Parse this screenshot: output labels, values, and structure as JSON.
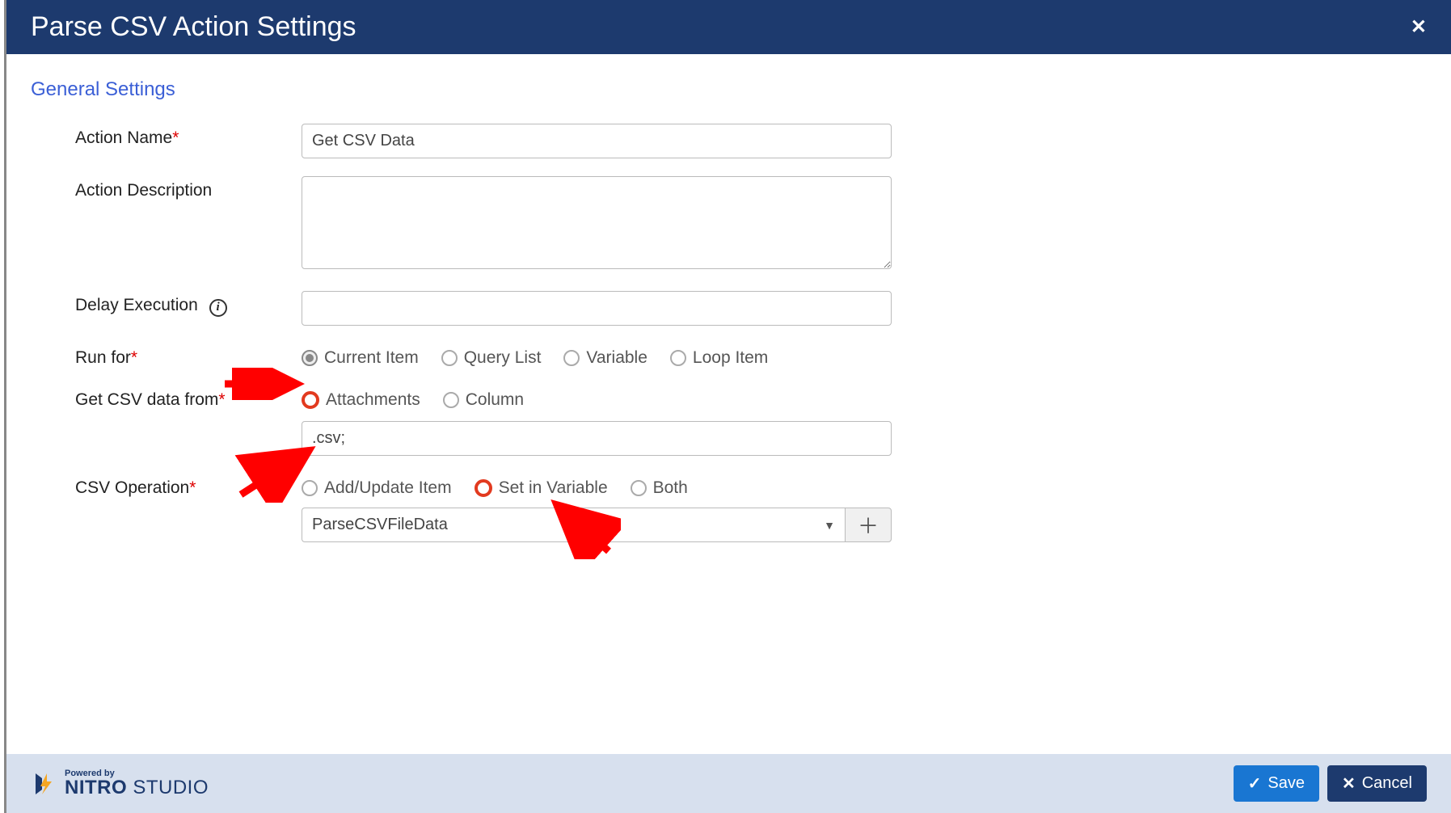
{
  "header": {
    "title": "Parse CSV Action Settings"
  },
  "section": {
    "title": "General Settings"
  },
  "labels": {
    "action_name": "Action Name",
    "action_description": "Action Description",
    "delay_execution": "Delay Execution",
    "run_for": "Run for",
    "get_csv": "Get CSV data from",
    "csv_op": "CSV Operation"
  },
  "values": {
    "action_name": "Get CSV Data",
    "action_description": "",
    "delay_execution": "",
    "csv_pattern": ".csv;",
    "variable_select": "ParseCSVFileData"
  },
  "options": {
    "run_for": [
      "Current Item",
      "Query List",
      "Variable",
      "Loop Item"
    ],
    "get_csv": [
      "Attachments",
      "Column"
    ],
    "csv_op": [
      "Add/Update Item",
      "Set in Variable",
      "Both"
    ]
  },
  "footer": {
    "powered_by": "Powered by",
    "brand1": "NITRO",
    "brand2": "STUDIO",
    "save": "Save",
    "cancel": "Cancel"
  }
}
